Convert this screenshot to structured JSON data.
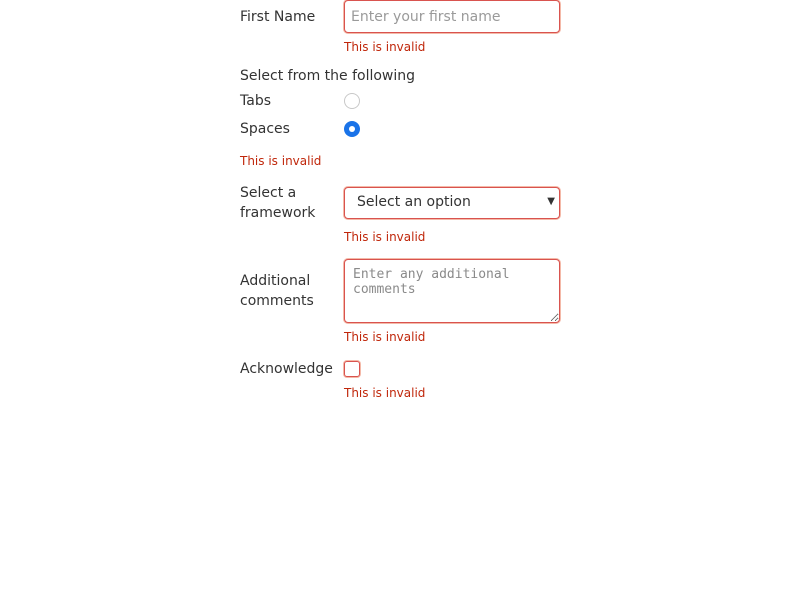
{
  "first_name": {
    "label": "First Name",
    "placeholder": "Enter your first name",
    "value": "",
    "error": "This is invalid"
  },
  "indentation": {
    "label": "Select from the following",
    "options": [
      {
        "label": "Tabs",
        "checked": false
      },
      {
        "label": "Spaces",
        "checked": true
      }
    ],
    "error": "This is invalid"
  },
  "framework": {
    "label_line1": "Select a",
    "label_line2": "framework",
    "selected": "Select an option",
    "error": "This is invalid"
  },
  "comments": {
    "label_line1": "Additional",
    "label_line2": "comments",
    "placeholder": "Enter any additional comments",
    "error": "This is invalid"
  },
  "acknowledge": {
    "label": "Acknowledge",
    "checked": false,
    "error": "This is invalid"
  },
  "colors": {
    "error": "#c0270b",
    "invalid_border": "#d9534f",
    "radio_checked": "#1a73e8"
  }
}
